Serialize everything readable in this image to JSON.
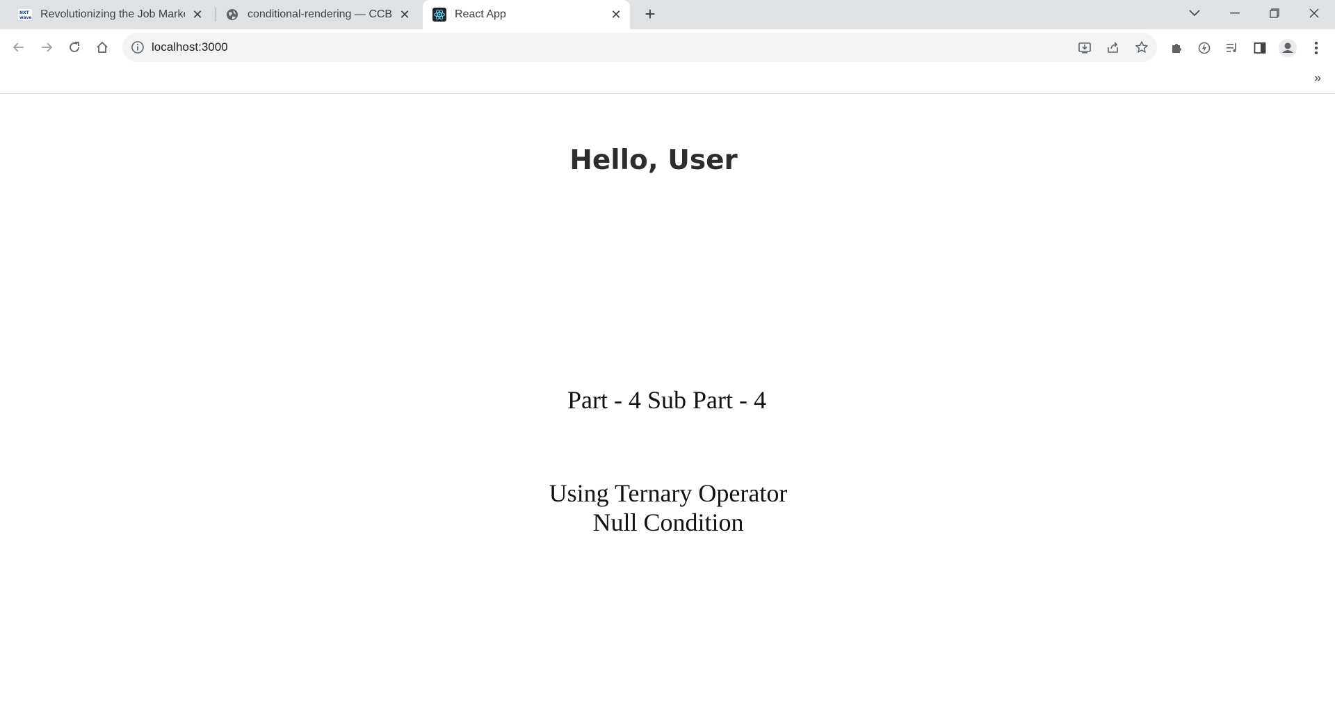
{
  "browser": {
    "tabs": [
      {
        "title": "Revolutionizing the Job Market |",
        "favicon": "nxtwave-logo-icon",
        "active": false
      },
      {
        "title": "conditional-rendering — CCBP ID",
        "favicon": "globe-icon",
        "active": false
      },
      {
        "title": "React App",
        "favicon": "react-logo-icon",
        "active": true
      }
    ],
    "new_tab_label": "+",
    "address": "localhost:3000",
    "bookmarks_overflow": "»"
  },
  "page": {
    "greeting": "Hello, User",
    "part_heading": "Part - 4 Sub Part - 4",
    "ternary_line1": "Using Ternary Operator",
    "ternary_line2": "Null Condition"
  }
}
